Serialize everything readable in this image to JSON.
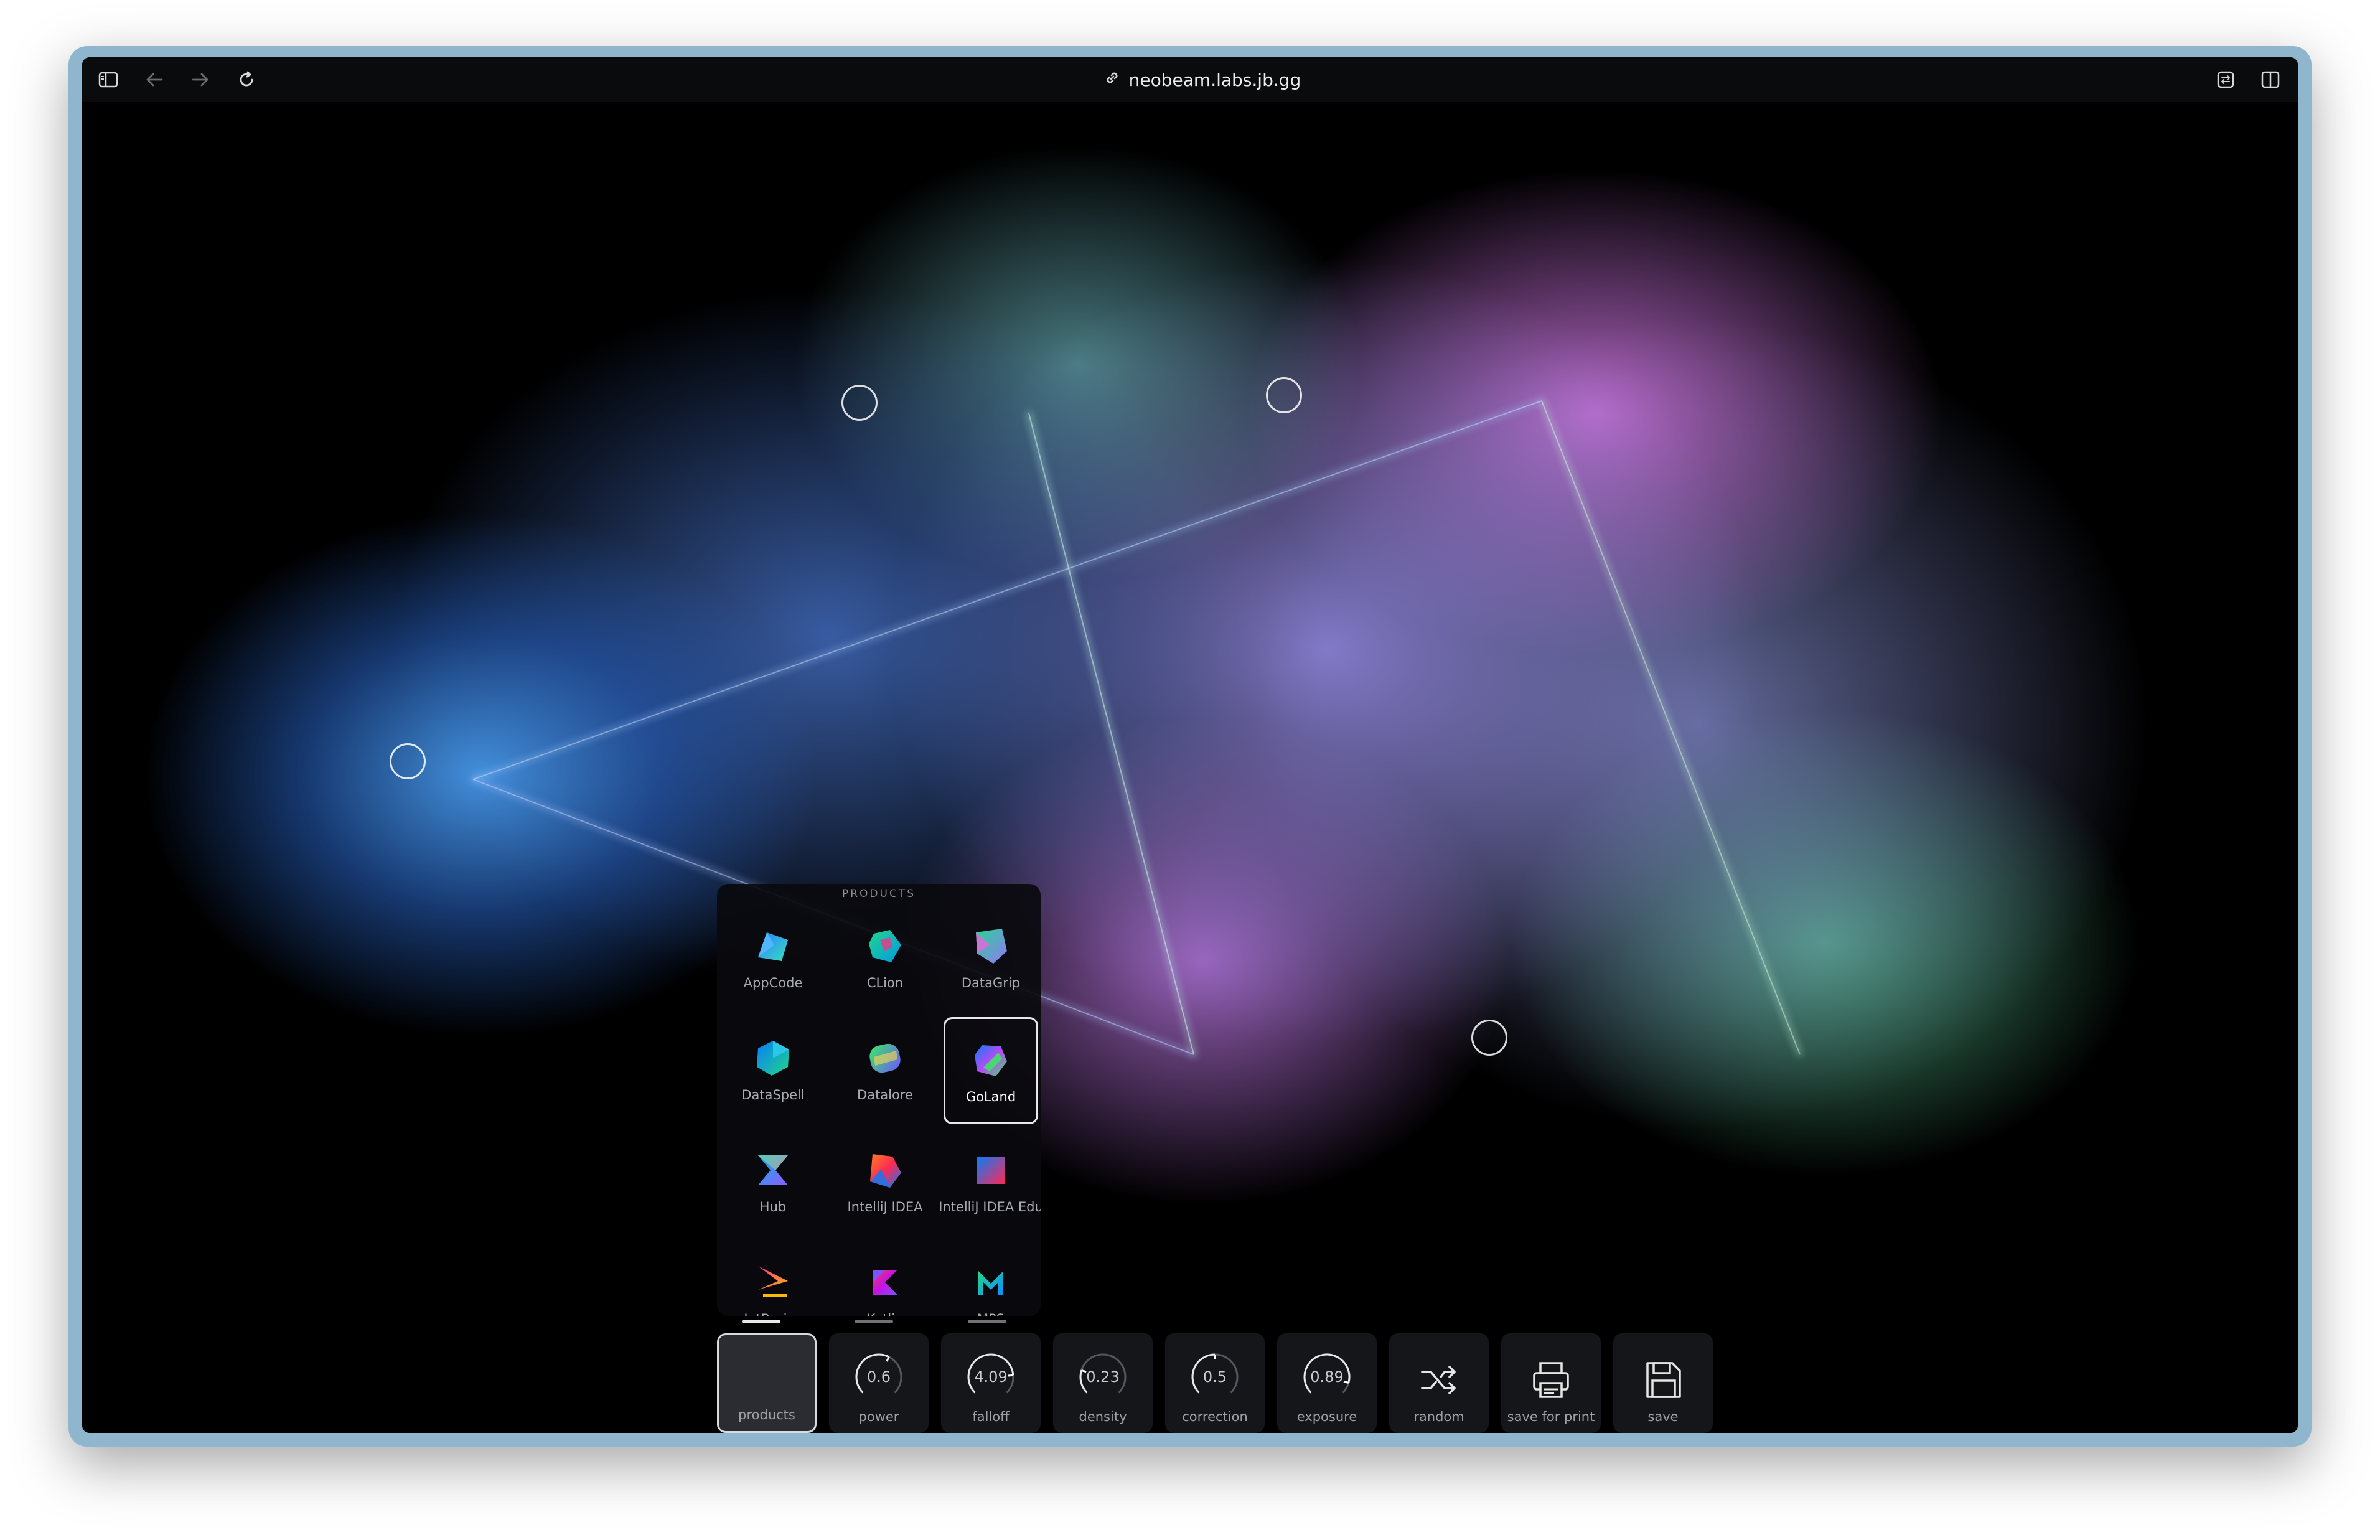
{
  "browser": {
    "url": "neobeam.labs.jb.gg"
  },
  "products_panel": {
    "title": "PRODUCTS",
    "items": [
      {
        "label": "AppCode",
        "icon": "appcode-icon",
        "selected": false
      },
      {
        "label": "CLion",
        "icon": "clion-icon",
        "selected": false
      },
      {
        "label": "DataGrip",
        "icon": "datagrip-icon",
        "selected": false
      },
      {
        "label": "DataSpell",
        "icon": "dataspell-icon",
        "selected": false
      },
      {
        "label": "Datalore",
        "icon": "datalore-icon",
        "selected": false
      },
      {
        "label": "GoLand",
        "icon": "goland-icon",
        "selected": true
      },
      {
        "label": "Hub",
        "icon": "hub-icon",
        "selected": false
      },
      {
        "label": "IntelliJ IDEA",
        "icon": "intellij-idea-icon",
        "selected": false
      },
      {
        "label": "IntelliJ IDEA Edu",
        "icon": "intellij-idea-edu-icon",
        "selected": false
      },
      {
        "label": "JetBrains",
        "icon": "jetbrains-icon",
        "selected": false
      },
      {
        "label": "Kotlin",
        "icon": "kotlin-icon",
        "selected": false
      },
      {
        "label": "MPS",
        "icon": "mps-icon",
        "selected": false
      }
    ]
  },
  "controls": [
    {
      "label": "products",
      "type": "product",
      "active": true
    },
    {
      "label": "power",
      "type": "knob",
      "value": "0.6"
    },
    {
      "label": "falloff",
      "type": "knob",
      "value": "4.09"
    },
    {
      "label": "density",
      "type": "knob",
      "value": "0.23"
    },
    {
      "label": "correction",
      "type": "knob",
      "value": "0.5"
    },
    {
      "label": "exposure",
      "type": "knob",
      "value": "0.89"
    },
    {
      "label": "random",
      "type": "button",
      "icon": "shuffle-icon"
    },
    {
      "label": "save for print",
      "type": "button",
      "icon": "printer-icon"
    },
    {
      "label": "save",
      "type": "button",
      "icon": "floppy-disk-icon"
    }
  ]
}
